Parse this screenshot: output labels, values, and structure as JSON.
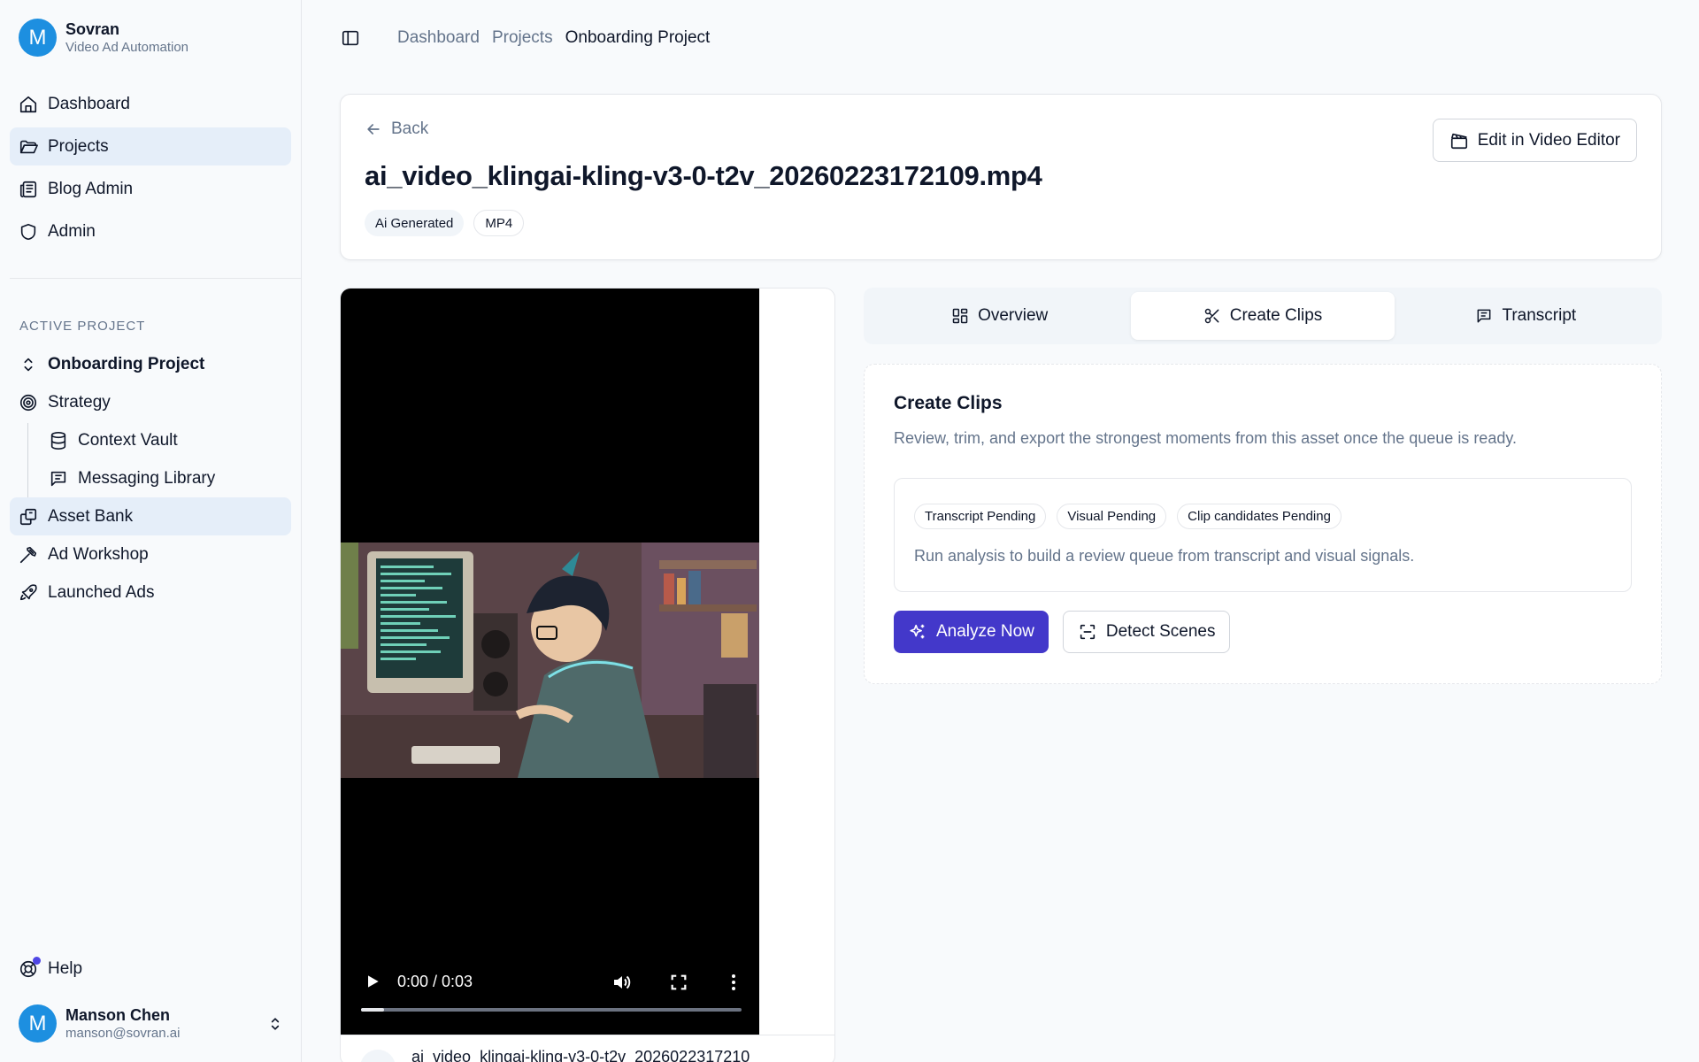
{
  "brand": {
    "initial": "M",
    "name": "Sovran",
    "subtitle": "Video Ad Automation"
  },
  "nav": [
    {
      "label": "Dashboard",
      "icon": "home-icon"
    },
    {
      "label": "Projects",
      "icon": "folder-open-icon",
      "active": true
    },
    {
      "label": "Blog Admin",
      "icon": "newspaper-icon"
    },
    {
      "label": "Admin",
      "icon": "shield-icon"
    }
  ],
  "active_project": {
    "section_label": "ACTIVE PROJECT",
    "name": "Onboarding Project",
    "items": [
      {
        "label": "Strategy",
        "icon": "target-icon"
      },
      {
        "label": "Context Vault",
        "icon": "database-icon",
        "sub": true
      },
      {
        "label": "Messaging Library",
        "icon": "message-square-icon",
        "sub": true
      },
      {
        "label": "Asset Bank",
        "icon": "images-icon",
        "active": true
      },
      {
        "label": "Ad Workshop",
        "icon": "hammer-icon"
      },
      {
        "label": "Launched Ads",
        "icon": "rocket-icon"
      }
    ]
  },
  "help": {
    "label": "Help"
  },
  "user": {
    "initial": "M",
    "name": "Manson Chen",
    "email": "manson@sovran.ai"
  },
  "breadcrumb": [
    "Dashboard",
    "Projects",
    "Onboarding Project"
  ],
  "asset": {
    "back_label": "Back",
    "title": "ai_video_klingai-kling-v3-0-t2v_20260223172109.mp4",
    "tags": [
      "Ai Generated",
      "MP4"
    ],
    "edit_button": "Edit in Video Editor"
  },
  "player": {
    "time": "0:00 / 0:03",
    "progress": 0.06,
    "caption": "ai_video_klingai-kling-v3-0-t2v_2026022317210"
  },
  "tabs": [
    {
      "label": "Overview",
      "icon": "layout-grid-icon"
    },
    {
      "label": "Create Clips",
      "icon": "scissors-icon",
      "active": true
    },
    {
      "label": "Transcript",
      "icon": "message-text-icon"
    }
  ],
  "clips": {
    "title": "Create Clips",
    "description": "Review, trim, and export the strongest moments from this asset once the queue is ready.",
    "pills": [
      "Transcript Pending",
      "Visual Pending",
      "Clip candidates Pending"
    ],
    "status_text": "Run analysis to build a review queue from transcript and visual signals.",
    "analyze_button": "Analyze Now",
    "detect_button": "Detect Scenes"
  },
  "colors": {
    "accent": "#4338ca",
    "avatar": "#1d8fe0",
    "active_nav": "#e5eef9"
  }
}
